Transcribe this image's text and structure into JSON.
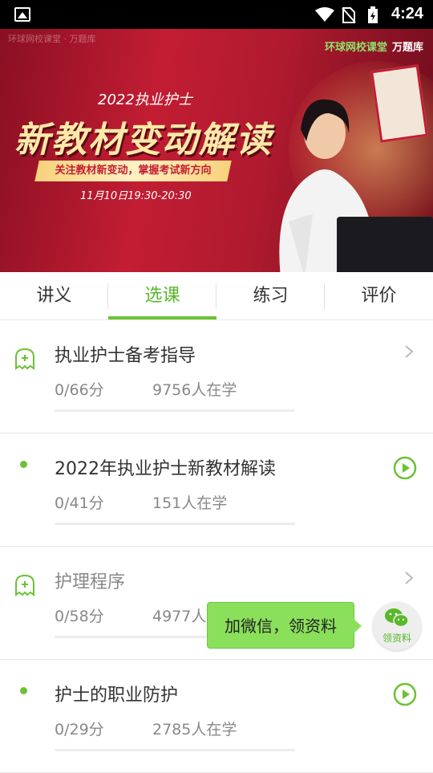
{
  "status_bar": {
    "time": "4:24"
  },
  "banner": {
    "brand_left": "环球网校课堂 · 万题库",
    "brand_right_a": "环球网校课堂",
    "brand_right_b": "万题库",
    "subtitle": "2022执业护士",
    "headline": "新教材变动解读",
    "ribbon": "关注教材新变动，掌握考试新方向",
    "datetime": "11月10日19:30-20:30"
  },
  "tabs": [
    {
      "label": "讲义",
      "active": false
    },
    {
      "label": "选课",
      "active": true
    },
    {
      "label": "练习",
      "active": false
    },
    {
      "label": "评价",
      "active": false
    }
  ],
  "courses": [
    {
      "title": "执业护士备考指导",
      "score": "0/66分",
      "learners": "9756人在学",
      "icon": "ghost-plus-icon",
      "action": "chevron-right-icon"
    },
    {
      "title": "2022年执业护士新教材解读",
      "score": "0/41分",
      "learners": "151人在学",
      "icon": "green-dot",
      "action": "play-icon"
    },
    {
      "title": "护理程序",
      "score": "0/58分",
      "learners": "4977人在学",
      "icon": "ghost-plus-icon",
      "action": "chevron-right-icon"
    },
    {
      "title": "护士的职业防护",
      "score": "0/29分",
      "learners": "2785人在学",
      "icon": "green-dot",
      "action": "play-icon"
    }
  ],
  "promo": {
    "text": "加微信，领资料"
  },
  "wechat_fab": {
    "label": "领资料"
  },
  "colors": {
    "accent": "#6cc234",
    "banner_red": "#c21d33"
  }
}
